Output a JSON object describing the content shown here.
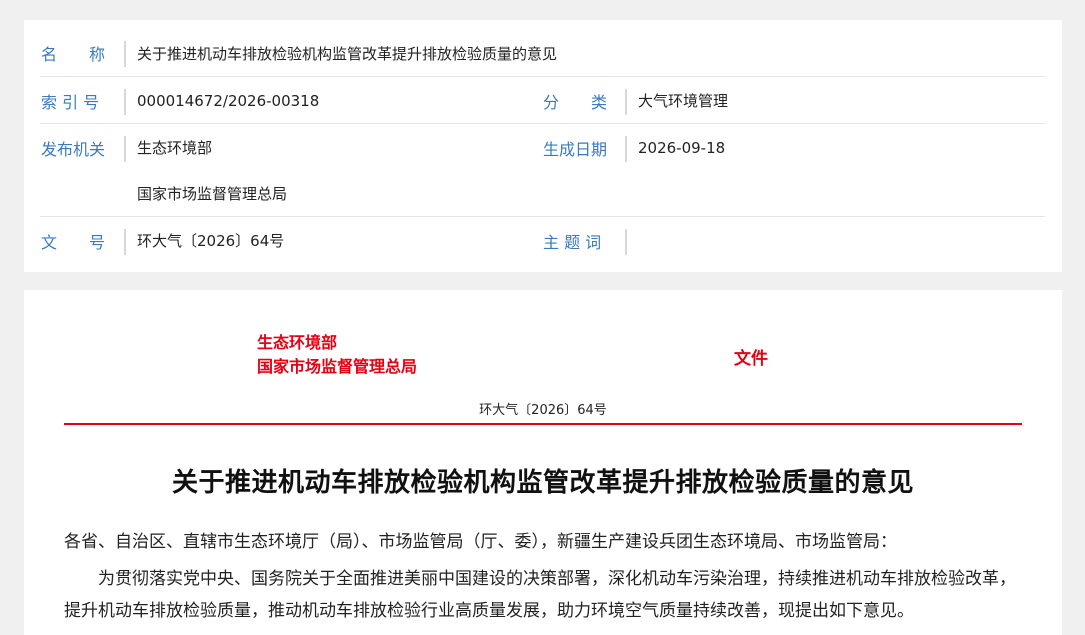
{
  "meta": {
    "name_label": "名　　称",
    "name_value": "关于推进机动车排放检验机构监管改革提升排放检验质量的意见",
    "index_label": "索 引 号",
    "index_value": "000014672/2026-00318",
    "category_label": "分　　类",
    "category_value": "大气环境管理",
    "issuer_label": "发布机关",
    "issuer_value_1": "生态环境部",
    "issuer_value_2": "国家市场监督管理总局",
    "date_label": "生成日期",
    "date_value": "2026-09-18",
    "docno_label": "文　　号",
    "docno_value": "环大气〔2026〕64号",
    "subject_label": "主 题 词",
    "subject_value": ""
  },
  "document": {
    "issuer_1": "生态环境部",
    "issuer_2": "国家市场监督管理总局",
    "wenjian": "文件",
    "doc_number": "环大气〔2026〕64号",
    "title": "关于推进机动车排放检验机构监管改革提升排放检验质量的意见",
    "salutation": "各省、自治区、直辖市生态环境厅（局）、市场监管局（厅、委），新疆生产建设兵团生态环境局、市场监管局：",
    "paragraph_1": "为贯彻落实党中央、国务院关于全面推进美丽中国建设的决策部署，深化机动车污染治理，持续推进机动车排放检验改革，提升机动车排放检验质量，推动机动车排放检验行业高质量发展，助力环境空气质量持续改善，现提出如下意见。"
  },
  "colors": {
    "label_blue": "#3a7bbf",
    "red": "#e60012"
  }
}
